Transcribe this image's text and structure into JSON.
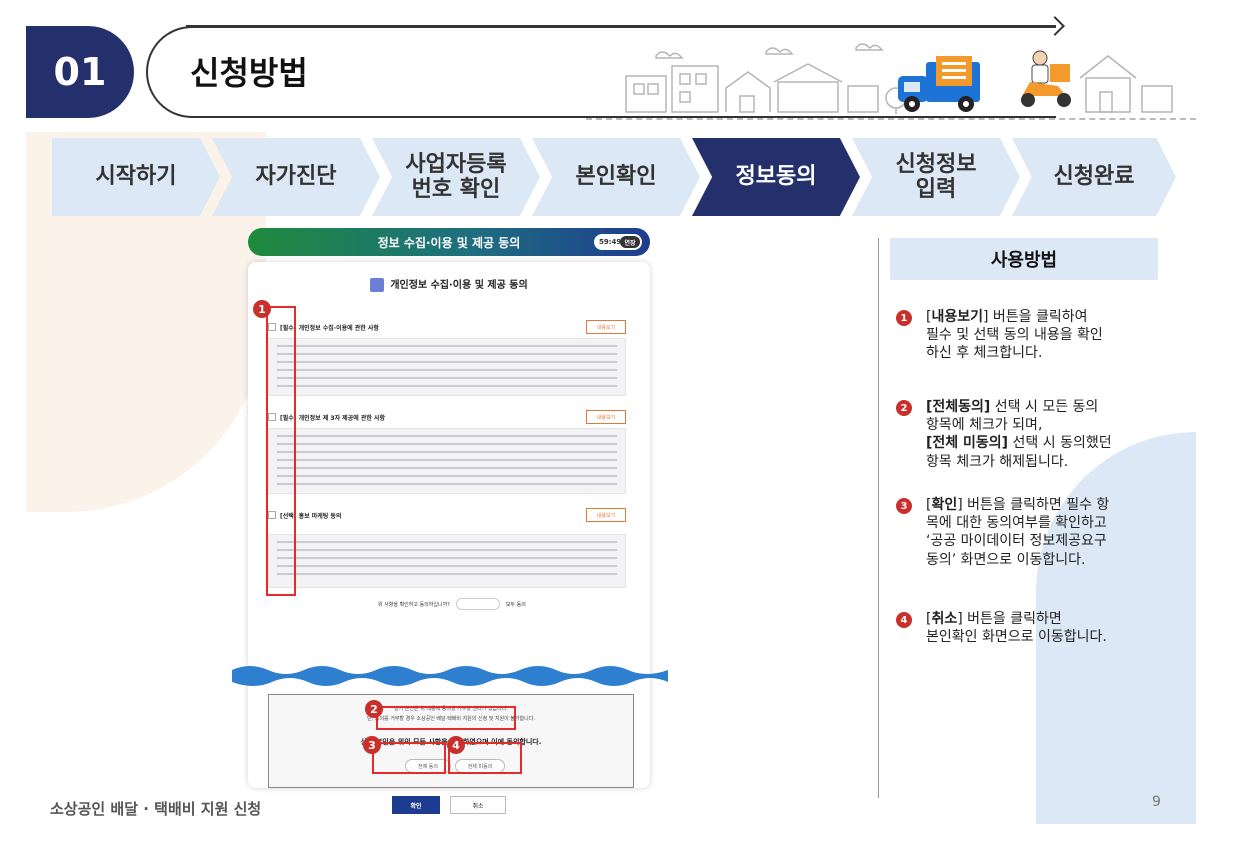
{
  "header": {
    "number": "01",
    "title": "신청방법"
  },
  "steps": [
    {
      "label": "시작하기",
      "active": false
    },
    {
      "label": "자가진단",
      "active": false
    },
    {
      "label": "사업자등록\n번호 확인",
      "active": false
    },
    {
      "label": "본인확인",
      "active": false
    },
    {
      "label": "정보동의",
      "active": true
    },
    {
      "label": "신청정보\n입력",
      "active": false
    },
    {
      "label": "신청완료",
      "active": false
    }
  ],
  "screenshot": {
    "bar_title": "정보 수집·이용 및 제공 동의",
    "timer": "59:49",
    "timer_btn": "연장",
    "card_title": "개인정보 수집·이용 및 제공 동의",
    "sections": [
      {
        "title": "[필수] 개인정보 수집·이용에 관한 사항",
        "view_label": "내용보기"
      },
      {
        "title": "[필수] 개인정보 제 3자 제공에 관한 사항",
        "view_label": "내용보기"
      },
      {
        "title": "[선택] 홍보 마케팅 동의",
        "view_label": "내용보기"
      }
    ],
    "agree_question": "위 사항을 확인하고 동의하십니까?",
    "agree_option": "모두 동의",
    "confirm_line1": "상기 본인은 위 내용에 동의할 거부할 권리가 있습니다.",
    "confirm_line2": "단, 동의를 거부할 경우 소상공인 배달·택배비 지원의 신청 및 지원이 불가합니다.",
    "confirm_strong": "상기 본인은 위의 모든 사항을 확인하였으며 이에 동의합니다.",
    "choice_all": "전체 동의",
    "choice_none": "전체 미동의",
    "ok_label": "확인",
    "cancel_label": "취소"
  },
  "markers": [
    "1",
    "2",
    "3",
    "4"
  ],
  "usage": {
    "title": "사용방법",
    "items": [
      {
        "num": "1",
        "text_html": "[<b>내용보기</b>] 버튼을 클릭하여<br>필수 및 선택 동의 내용을 확인<br>하신 후 체크합니다."
      },
      {
        "num": "2",
        "text_html": "<b>[전체동의]</b> 선택 시 모든 동의<br>항목에 체크가 되며,<br><b>[전체 미동의]</b> 선택 시 동의했던<br>항목 체크가 해제됩니다."
      },
      {
        "num": "3",
        "text_html": "[<b>확인</b>] 버튼을 클릭하면 필수 항<br>목에 대한 동의여부를 확인하고<br>‘공공 마이데이터 정보제공요구<br>동의’ 화면으로 이동합니다."
      },
      {
        "num": "4",
        "text_html": "[<b>취소</b>] 버튼을 클릭하면<br>본인확인 화면으로 이동합니다."
      }
    ]
  },
  "footer": {
    "text": "소상공인 배달 · 택배비 지원 신청",
    "page": "9"
  },
  "colors": {
    "navy": "#24306b",
    "step_bg": "#dce8f5",
    "marker_red": "#c9302c",
    "box_red": "#e32b2b",
    "truck_blue": "#1e73d6",
    "truck_orange": "#f39a2b"
  }
}
